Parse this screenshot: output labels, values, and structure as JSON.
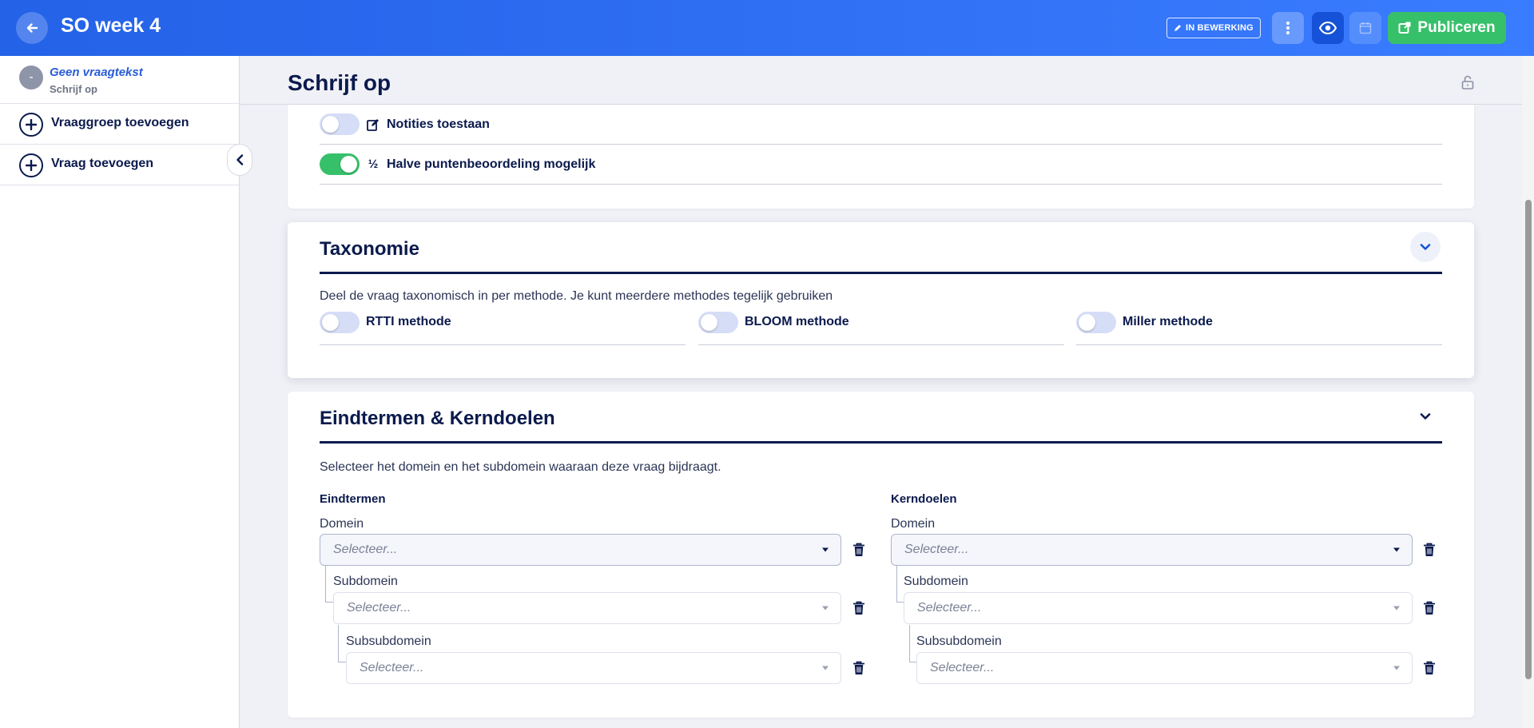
{
  "topbar": {
    "title": "SO week 4",
    "status_badge": "IN BEWERKING",
    "publish_label": "Publiceren"
  },
  "sidebar": {
    "current_question": {
      "avatar": "-",
      "title": "Geen vraagtekst",
      "subtitle": "Schrijf op"
    },
    "add_group_label": "Vraaggroep toevoegen",
    "add_question_label": "Vraag toevoegen"
  },
  "main": {
    "page_title": "Schrijf op",
    "settings": {
      "notes": {
        "label": "Notities toestaan",
        "enabled": false
      },
      "half_points": {
        "label": "Halve puntenbeoordeling mogelijk",
        "icon_text": "½",
        "enabled": true
      }
    },
    "taxonomy": {
      "title": "Taxonomie",
      "description": "Deel de vraag taxonomisch in per methode. Je kunt meerdere methodes tegelijk gebruiken",
      "methods": [
        {
          "label": "RTTI methode",
          "enabled": false
        },
        {
          "label": "BLOOM methode",
          "enabled": false
        },
        {
          "label": "Miller methode",
          "enabled": false
        }
      ]
    },
    "eindtermen": {
      "title": "Eindtermen & Kerndoelen",
      "description": "Selecteer het domein en het subdomein waaraan deze vraag bijdraagt.",
      "columns": [
        {
          "title": "Eindtermen",
          "domain_label": "Domein",
          "subdomain_label": "Subdomein",
          "subsubdomain_label": "Subsubdomein",
          "placeholder": "Selecteer..."
        },
        {
          "title": "Kerndoelen",
          "domain_label": "Domein",
          "subdomain_label": "Subdomein",
          "subsubdomain_label": "Subsubdomein",
          "placeholder": "Selecteer..."
        }
      ]
    }
  },
  "colors": {
    "topbar": "#2f6ff2",
    "publish": "#37c06a",
    "navy": "#0b1a4d",
    "toggle_off": "#d5ddf7",
    "toggle_on": "#37c06a"
  },
  "icons": {
    "back": "arrow-left-icon",
    "status": "pencil-icon",
    "more": "vertical-dots-icon",
    "preview": "eye-icon",
    "schedule": "calendar-icon",
    "publish": "external-link-icon",
    "lock": "unlock-icon",
    "notes": "edit-note-icon",
    "delete": "trash-icon"
  }
}
